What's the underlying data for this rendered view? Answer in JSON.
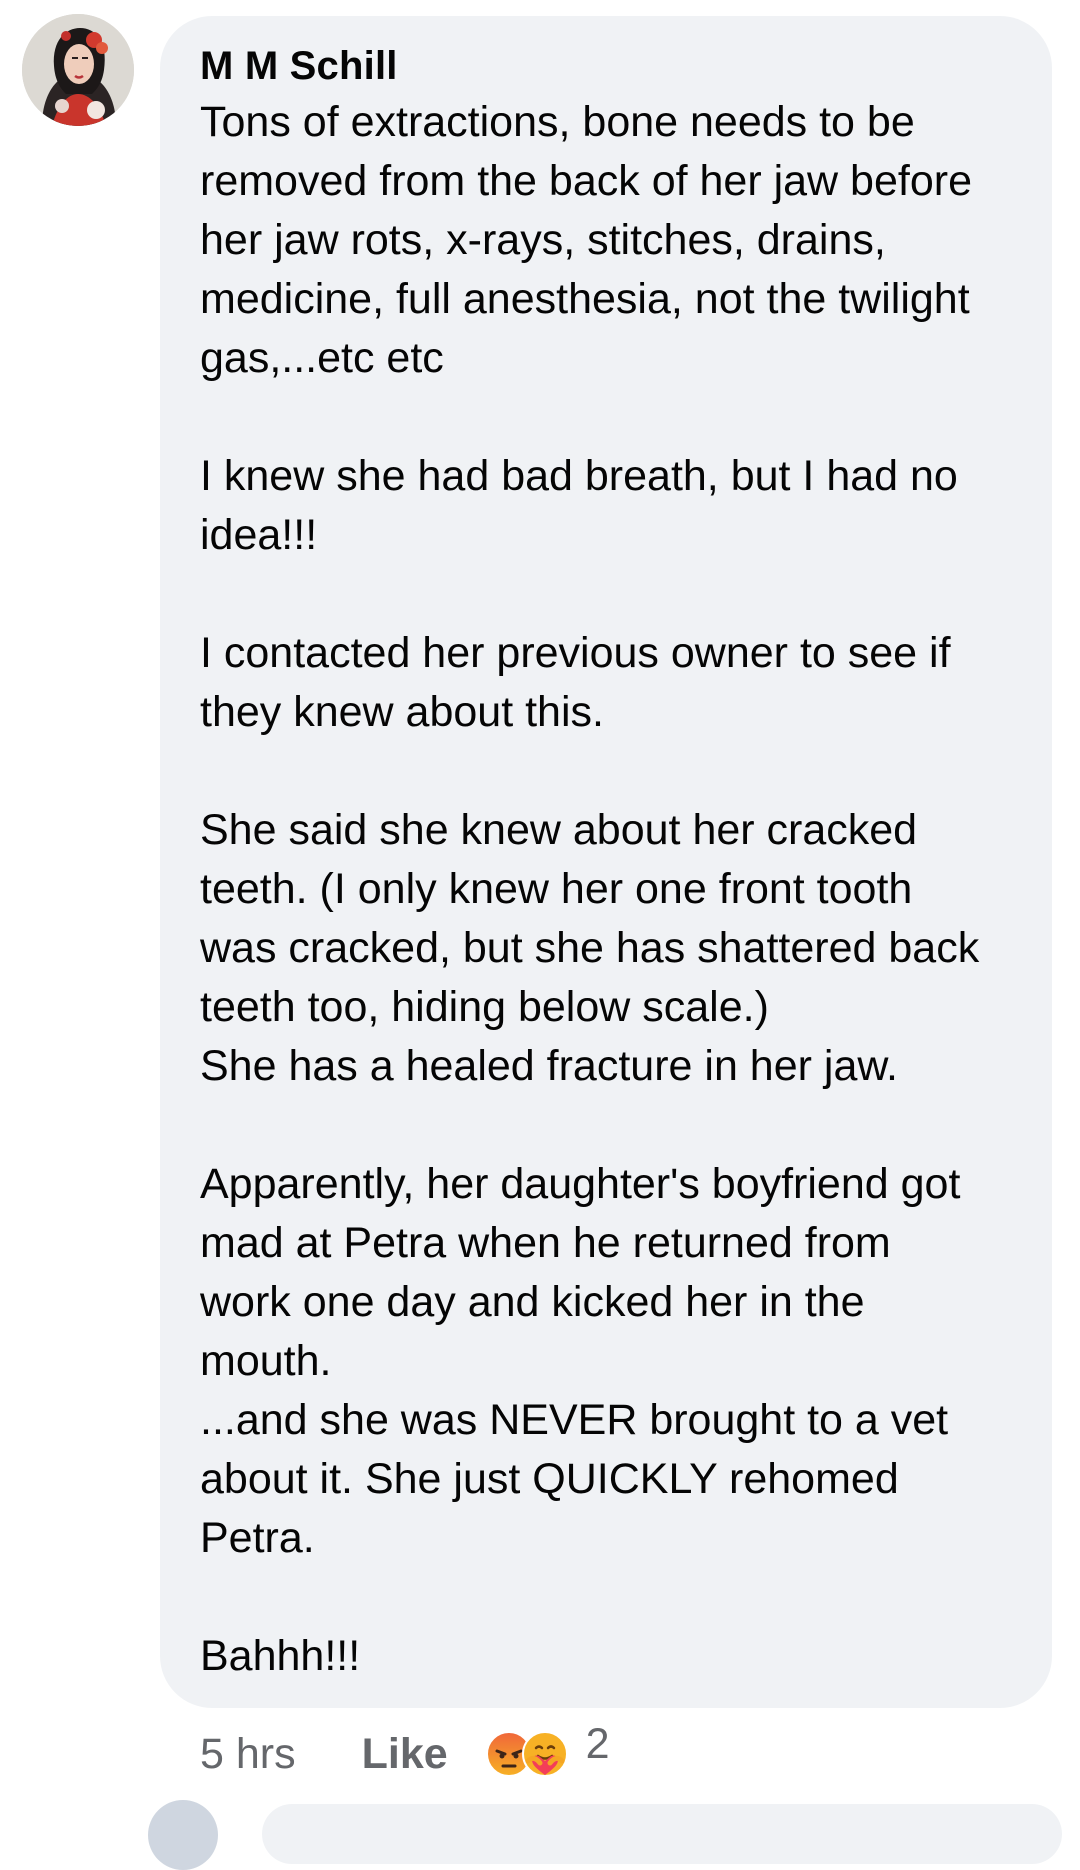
{
  "comment": {
    "author": "M M Schill",
    "paragraphs": [
      [
        "Tons of extractions, bone needs to be",
        "removed from the back of her jaw before",
        "her jaw rots, x-rays, stitches, drains,",
        "medicine, full anesthesia, not the twilight",
        "gas,...etc etc"
      ],
      [
        "I knew she had bad breath, but I had no",
        "idea!!!"
      ],
      [
        "I contacted her previous owner to see if",
        "they knew about this."
      ],
      [
        "She said she knew about her cracked",
        "teeth. (I only knew her one front tooth",
        "was cracked, but she has shattered back",
        "teeth too, hiding below scale.)",
        "She has a healed fracture in her jaw."
      ],
      [
        "Apparently, her daughter's boyfriend got",
        "mad at Petra when he returned from",
        "work one day and kicked her in the",
        "mouth.",
        "...and she was NEVER brought to a vet",
        "about it. She just QUICKLY rehomed",
        "Petra."
      ],
      [
        "Bahhh!!!"
      ]
    ]
  },
  "actions": {
    "timestamp": "5 hrs",
    "like_label": "Like",
    "reactions": [
      "angry-reaction-icon",
      "care-reaction-icon"
    ],
    "reaction_count": "2"
  },
  "colors": {
    "bubble_bg": "#f0f2f5",
    "secondary_text": "#65676b",
    "angry": "#f0663a",
    "care": "#f7b125"
  }
}
